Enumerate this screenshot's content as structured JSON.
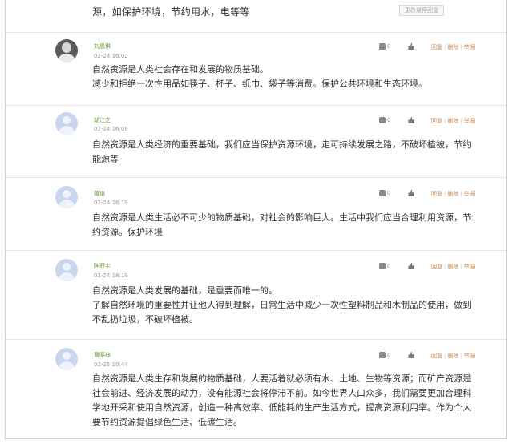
{
  "top_snippet": "源，如保护环境，节约用水，电等等",
  "tooltip": "更改悬停回复",
  "comments": [
    {
      "name": "刘晨琪",
      "time": "02-24 16:02",
      "lines": [
        "自然资源是人类社会存在和发展的物质基础。",
        "减少和拒绝一次性用品如筷子、杯子、纸巾、袋子等消费。保护公共环境和生态环境。"
      ],
      "count": "0",
      "avatar": "photo"
    },
    {
      "name": "胡江之",
      "time": "02-24 16:09",
      "lines": [
        "自然资源是人类经济的重要基础，我们应当保护资源环境，走可持续发展之路，不破坏植被，节约",
        "能源等"
      ],
      "count": "0",
      "avatar": "default"
    },
    {
      "name": "蒋琪",
      "time": "02-24 16:19",
      "lines": [
        "自然资源是人类生活必不可少的物质基础，对社会的影响巨大。生活中我们应当合理利用资源，节",
        "约资源。保护环境"
      ],
      "count": "0",
      "avatar": "default"
    },
    {
      "name": "陈冠宇",
      "time": "02-24 18:19",
      "lines": [
        "自然资源是人类发展的基础，是重要而唯一的。",
        "了解自然环境的重要性并让他人得到理解，日常生活中减少一次性塑料制品和木制品的使用，做到",
        "不乱扔垃圾，不破坏植被。"
      ],
      "count": "0",
      "avatar": "default"
    },
    {
      "name": "曹昭林",
      "time": "02-25 10:44",
      "lines": [
        "自然资源是人类生存和发展的物质基础，人要活着就必须有水、土地、生物等资源；而矿产资源是",
        "社会前进、经济发展的动力，没有能源社会将停滞不前。如今世界人口众多，我们需要更加合理科",
        "学地开采和使用自然资源，创造一种高效率、低能耗的生产生活方式，提高资源利用率。作为个人",
        "要节约资源提倡绿色生活、低碳生活。"
      ],
      "count": "0",
      "avatar": "default"
    }
  ],
  "actions": {
    "reply": "回复",
    "delete": "删除",
    "report": "举报"
  }
}
